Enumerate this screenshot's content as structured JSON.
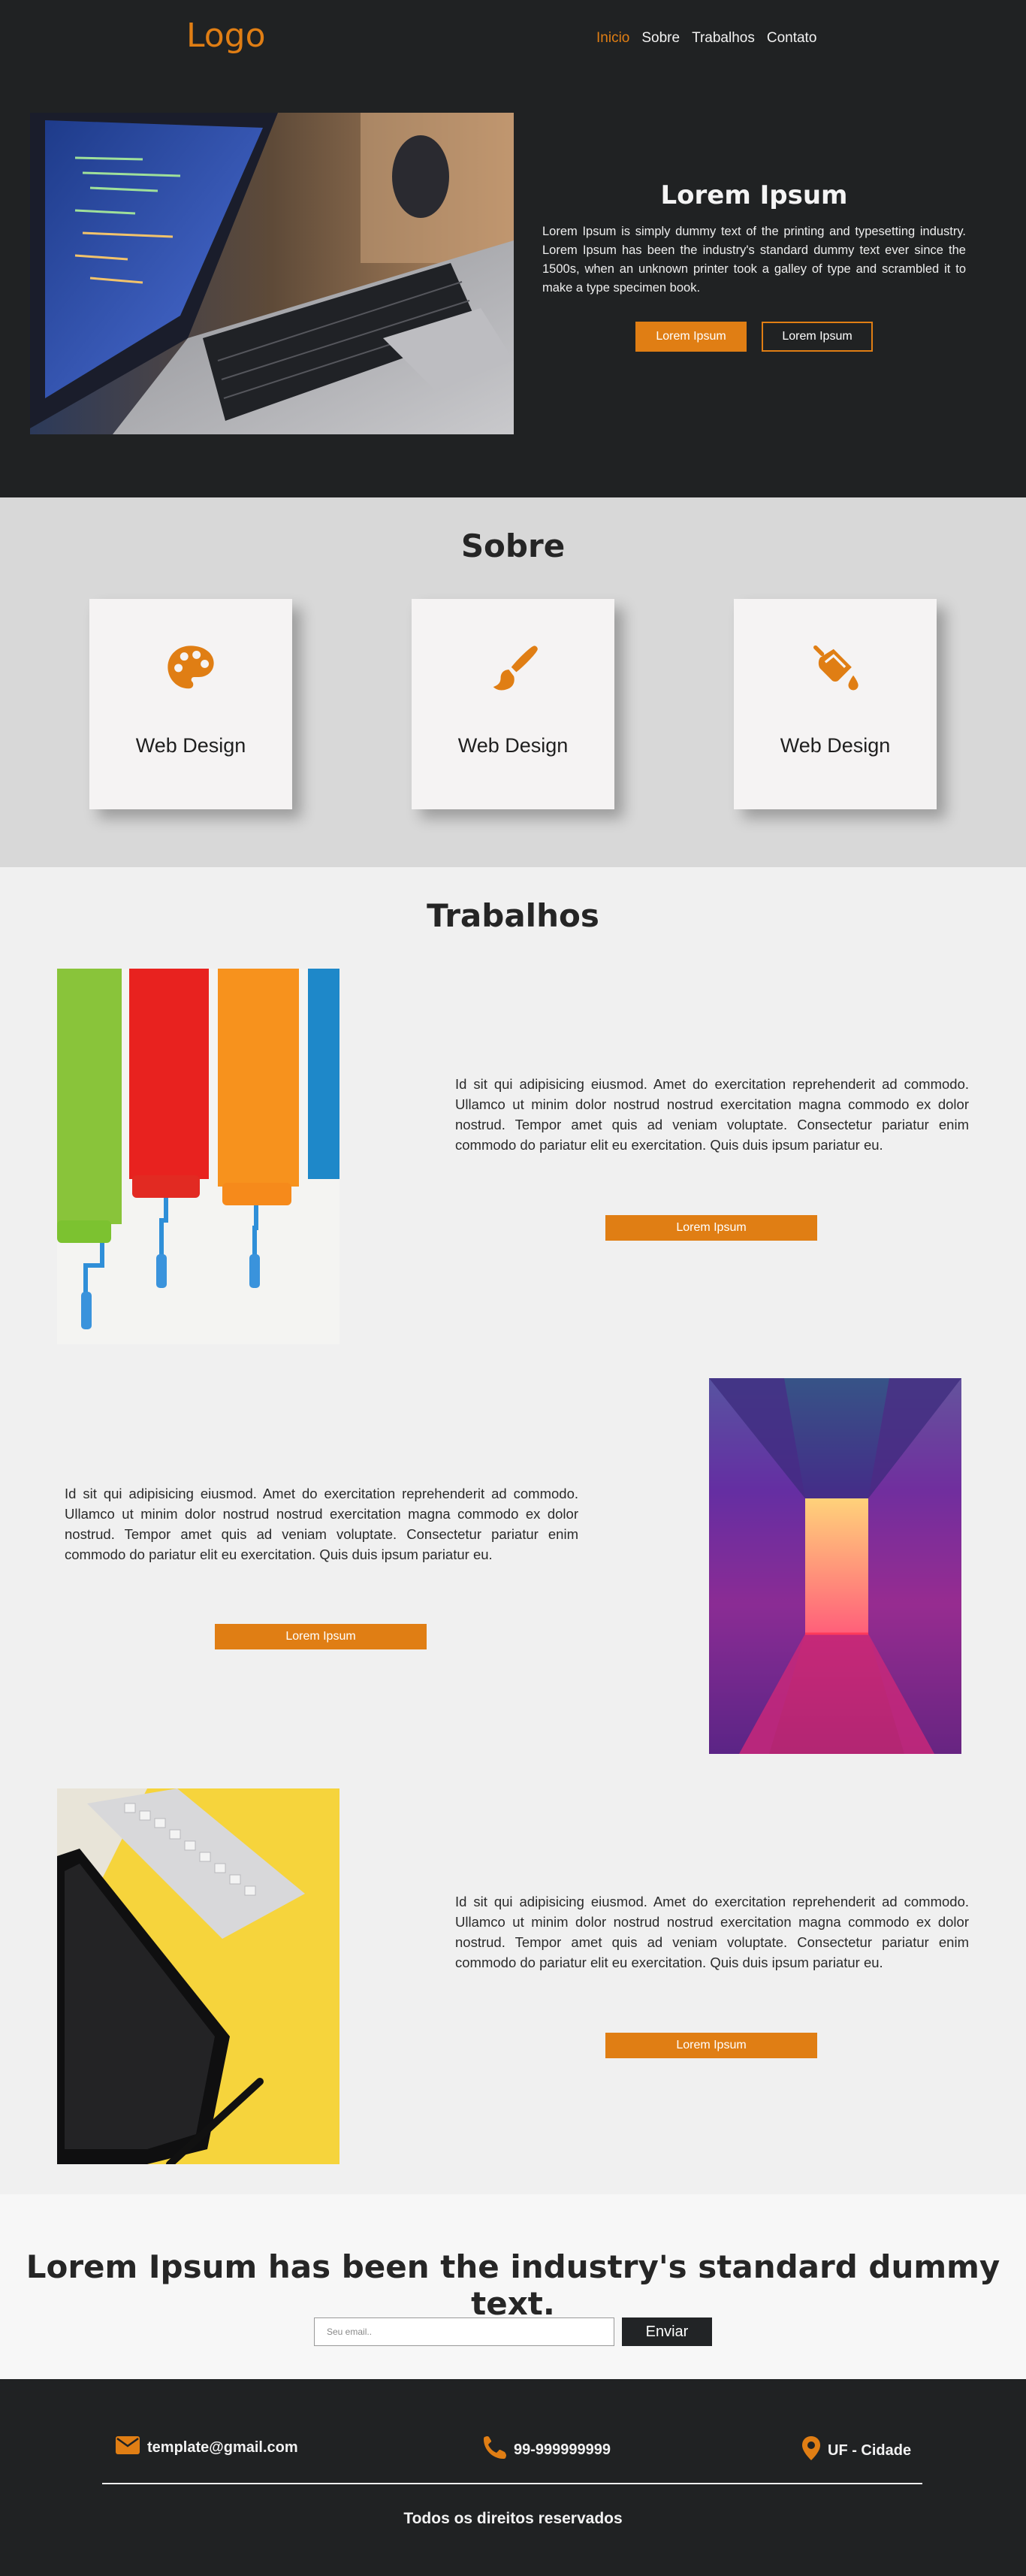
{
  "header": {
    "logo": "Logo",
    "nav": [
      {
        "label": "Inicio",
        "active": true
      },
      {
        "label": "Sobre",
        "active": false
      },
      {
        "label": "Trabalhos",
        "active": false
      },
      {
        "label": "Contato",
        "active": false
      }
    ]
  },
  "hero": {
    "title": "Lorem Ipsum",
    "description": "Lorem Ipsum is simply dummy text of the printing and typesetting industry. Lorem Ipsum has been the industry's standard dummy text ever since the 1500s, when an unknown printer took a galley of type and scrambled it to make a type specimen book.",
    "primary_button": "Lorem Ipsum",
    "secondary_button": "Lorem Ipsum",
    "image_icon": "laptop-code-photo"
  },
  "sobre": {
    "title": "Sobre",
    "cards": [
      {
        "icon": "palette-icon",
        "label": "Web Design"
      },
      {
        "icon": "paintbrush-icon",
        "label": "Web Design"
      },
      {
        "icon": "paint-bucket-icon",
        "label": "Web Design"
      }
    ]
  },
  "trabalhos": {
    "title": "Trabalhos",
    "items": [
      {
        "text": "Id sit qui adipisicing eiusmod. Amet do exercitation reprehenderit ad commodo. Ullamco ut minim dolor nostrud nostrud exercitation magna commodo ex dolor nostrud. Tempor amet quis ad veniam voluptate. Consectetur pariatur enim commodo do pariatur elit eu exercitation. Quis duis ipsum pariatur eu.",
        "button": "Lorem Ipsum",
        "image": "paint-rollers-photo"
      },
      {
        "text": "Id sit qui adipisicing eiusmod. Amet do exercitation reprehenderit ad commodo. Ullamco ut minim dolor nostrud nostrud exercitation magna commodo ex dolor nostrud. Tempor amet quis ad veniam voluptate. Consectetur pariatur enim commodo do pariatur elit eu exercitation. Quis duis ipsum pariatur eu.",
        "button": "Lorem Ipsum",
        "image": "neon-corridor-photo"
      },
      {
        "text": "Id sit qui adipisicing eiusmod. Amet do exercitation reprehenderit ad commodo. Ullamco ut minim dolor nostrud nostrud exercitation magna commodo ex dolor nostrud. Tempor amet quis ad veniam voluptate. Consectetur pariatur enim commodo do pariatur elit eu exercitation. Quis duis ipsum pariatur eu.",
        "button": "Lorem Ipsum",
        "image": "keyboard-tablet-photo"
      }
    ]
  },
  "newsletter": {
    "title": "Lorem Ipsum has been the industry's standard dummy text.",
    "email_placeholder": "Seu email..",
    "send_button": "Enviar"
  },
  "footer": {
    "email": "template@gmail.com",
    "phone": "99-999999999",
    "location": "UF - Cidade",
    "copyright": "Todos os direitos reservados"
  },
  "colors": {
    "accent": "#e07e14",
    "dark": "#202223",
    "light_gray": "#d8d8d8"
  }
}
